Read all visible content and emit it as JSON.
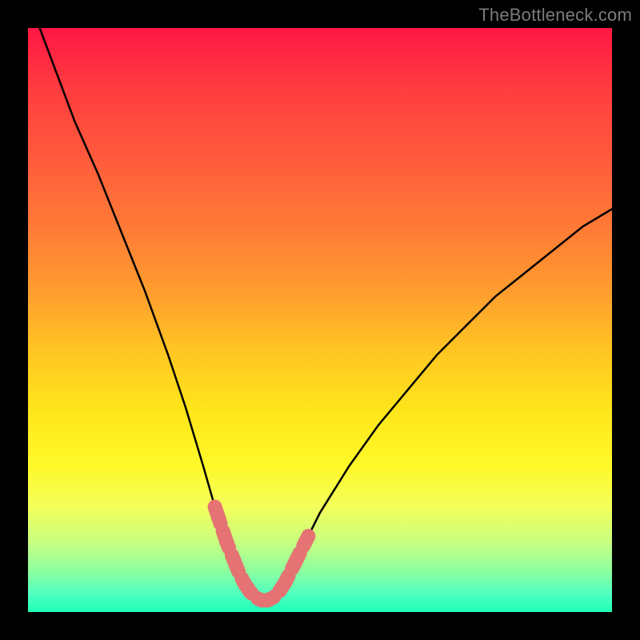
{
  "watermark": "TheBottleneck.com",
  "chart_data": {
    "type": "line",
    "title": "",
    "xlabel": "",
    "ylabel": "",
    "xlim": [
      0,
      100
    ],
    "ylim": [
      0,
      100
    ],
    "series": [
      {
        "name": "bottleneck-curve",
        "x": [
          2,
          5,
          8,
          12,
          16,
          20,
          24,
          27,
          30,
          32,
          34,
          36,
          37,
          38,
          39,
          40,
          41,
          42,
          43,
          44,
          46,
          48,
          50,
          55,
          60,
          65,
          70,
          75,
          80,
          85,
          90,
          95,
          100
        ],
        "y": [
          100,
          92,
          84,
          75,
          65,
          55,
          44,
          35,
          25,
          18,
          12,
          7,
          5,
          3.5,
          2.5,
          2,
          2,
          2.5,
          3.5,
          5,
          9,
          13,
          17,
          25,
          32,
          38,
          44,
          49,
          54,
          58,
          62,
          66,
          69
        ]
      }
    ],
    "highlight_segment": {
      "name": "optimal-range",
      "note": "thick salmon highlight near curve minimum",
      "x": [
        32,
        34,
        36,
        37,
        38,
        39,
        40,
        41,
        42,
        43,
        44,
        46,
        48
      ],
      "y": [
        18,
        12,
        7,
        5,
        3.5,
        2.5,
        2,
        2,
        2.5,
        3.5,
        5,
        9,
        13
      ]
    },
    "background_gradient": {
      "top": "#ff1744",
      "mid1": "#ff7a36",
      "mid2": "#ffe71b",
      "bottom": "#1fffb8"
    }
  }
}
